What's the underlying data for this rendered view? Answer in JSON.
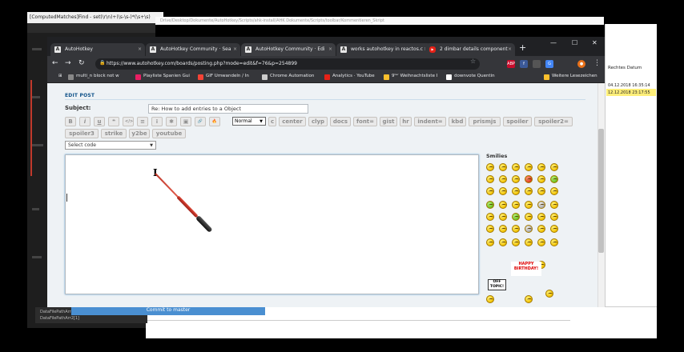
{
  "background": {
    "left_window_title": "[ComputedMatches]Find - set(\\r\\n)+(\\s-\\s-)*(\\s+\\s)",
    "top_strip_text": "Drive/Desktop/Dokumente/AutoHotkey/Scripts/ahk-install/AHK Dokumente/Scripts/toolbar/Kommentieren_Skript",
    "right_panel": {
      "header": "Rechtes Datum",
      "rows": [
        {
          "text": "04.12.2018 16:35:14",
          "selected": false
        },
        {
          "text": "12.12.2018 23:17:55",
          "selected": true
        }
      ]
    },
    "statusbar_lines": [
      "DataFilePathArr[1]",
      "DataFilePathArr2[1]"
    ]
  },
  "browser": {
    "tabs": [
      {
        "label": "AutoHotkey",
        "icon": "ahk-favicon",
        "active": false
      },
      {
        "label": "AutoHotkey Community · Sea",
        "icon": "ahk-favicon",
        "active": false
      },
      {
        "label": "AutoHotkey Community · Edi",
        "icon": "ahk-favicon",
        "active": true
      },
      {
        "label": "works autohotkey in reactos.c",
        "icon": "ahk-favicon",
        "active": false
      },
      {
        "label": "2 dimbar details component",
        "icon": "youtube-favicon",
        "active": false
      }
    ],
    "close_glyph": "×",
    "new_tab_glyph": "+",
    "window_controls": {
      "minimize": "—",
      "maximize": "☐",
      "close": "✕"
    },
    "nav": {
      "back": "←",
      "forward": "→",
      "reload": "↻"
    },
    "url": "https://www.autohotkey.com/boards/posting.php?mode=edit&f=76&p=254899",
    "bookmarks": [
      {
        "label": "multi_n block not w"
      },
      {
        "label": "Playliste Spanien Gui"
      },
      {
        "label": "GIF Umwandeln / In"
      },
      {
        "label": "Chrome Automation"
      },
      {
        "label": "Analytics · YouTube"
      },
      {
        "label": "9ᵗᵉʳ Weihnachtsliste I"
      },
      {
        "label": "downvote Quentin"
      },
      {
        "label": "Weitere Lesezeichen"
      }
    ],
    "extensions": [
      {
        "label": "ABP",
        "color": "#c70d2c"
      },
      {
        "label": "f",
        "color": "#3b5998"
      },
      {
        "label": "G",
        "color": "#4285f4"
      },
      {
        "label": "●",
        "color": "#e8711a"
      }
    ],
    "colors": {
      "tabstrip": "#202124",
      "toolbar": "#35363a",
      "accent": "#105289"
    }
  },
  "form": {
    "section_title": "EDIT POST",
    "subject_label": "Subject:",
    "subject_value": "Re: How to add entries to a Object",
    "format_icons": [
      {
        "label": "B",
        "name": "bold-button"
      },
      {
        "label": "i",
        "name": "italic-button"
      },
      {
        "label": "u",
        "name": "underline-button"
      },
      {
        "label": "❝",
        "name": "quote-button"
      },
      {
        "label": "</>",
        "name": "code-button"
      },
      {
        "label": "≡",
        "name": "list-button"
      },
      {
        "label": "⁝",
        "name": "ordered-list-button"
      },
      {
        "label": "✱",
        "name": "list-item-button"
      },
      {
        "label": "▣",
        "name": "image-button"
      },
      {
        "label": "🔗",
        "name": "link-button"
      },
      {
        "label": "🔥",
        "name": "flash-button"
      }
    ],
    "font_size_select": "Normal",
    "color_button": "c",
    "tags_row1": [
      "center",
      "clyp",
      "docs",
      "font=",
      "gist",
      "hr",
      "indent=",
      "kbd",
      "prismjs",
      "spoiler",
      "spoiler2="
    ],
    "tags_row2": [
      "spoiler3",
      "strike",
      "y2be",
      "youtube"
    ],
    "code_select": "Select code",
    "smilies_title": "Smilies",
    "birthday_badge": "HAPPY BIRTHDAY!",
    "offtopic_sign": "OFF TOPIC!",
    "submit_label": "Commit to master"
  }
}
